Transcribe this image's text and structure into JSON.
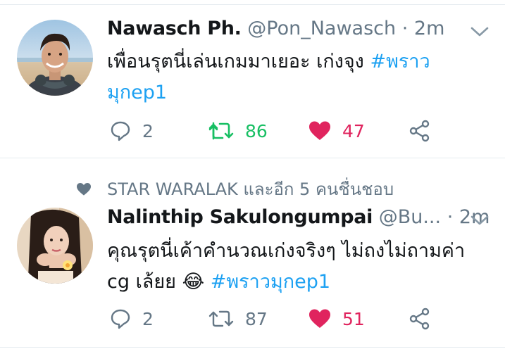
{
  "tweets": [
    {
      "name": "Nawasch Ph.",
      "handle": "@Pon_Nawasch",
      "separator": "·",
      "time": "2m",
      "text_line1": "เพื่อนรุตนี่เล่นเกมมาเยอะ เก่งจุง ",
      "hashtag_part1": "#พราว",
      "hashtag_part2": "มุกep1",
      "replies": "2",
      "retweets": "86",
      "likes": "47",
      "retweeted": true,
      "liked": true
    },
    {
      "social_context": "STAR WARALAK และอีก 5 คนชื่นชอบ",
      "name": "Nalinthip Sakulongumpai",
      "handle": "@Bu...",
      "separator": "·",
      "time": "2m",
      "text_line1": "คุณรุตนี่เค้าคำนวณเก่งจริงๆ ไม่ถงไม่ถามค่า",
      "text_line2": "cg เล้ยย ",
      "emoji": "😂",
      "hashtag": "#พราวมุกep1",
      "replies": "2",
      "retweets": "87",
      "likes": "51",
      "retweeted": false,
      "liked": true
    }
  ],
  "colors": {
    "link": "#1da1f2",
    "retweet_active": "#17bf63",
    "like_active": "#e0245e",
    "secondary": "#657786"
  },
  "icons": {
    "reply": "speech-bubble",
    "retweet": "retweet-arrows",
    "like": "heart",
    "share": "share-nodes",
    "menu": "chevron-down"
  }
}
